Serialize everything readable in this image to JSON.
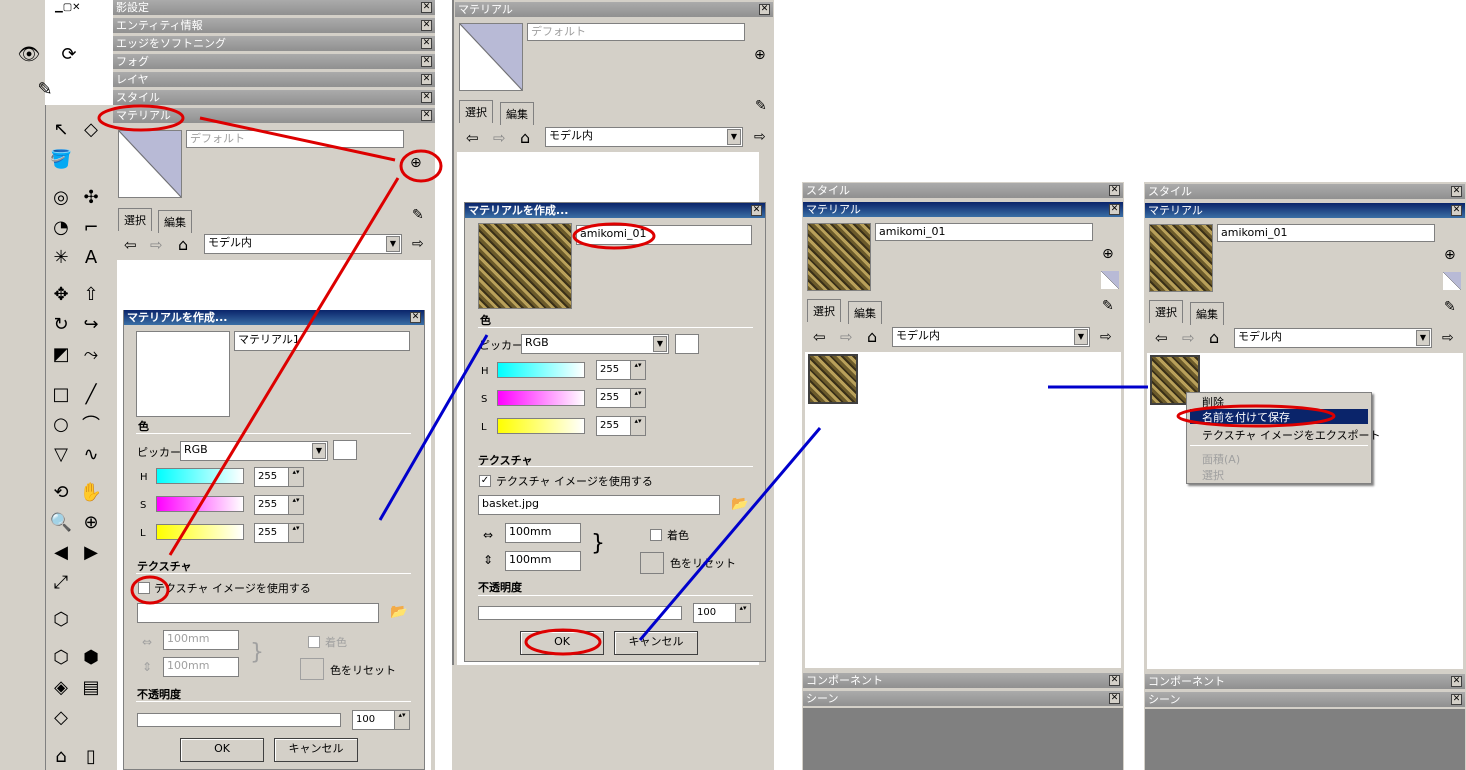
{
  "colors": {
    "blue_annot": "#0000cc",
    "red_annot": "#dd0000",
    "panel": "#d4d0c8"
  },
  "panels": {
    "shadow": "影設定",
    "entity": "エンティティ情報",
    "soften": "エッジをソフトニング",
    "fog": "フォグ",
    "layer": "レイヤ",
    "style": "スタイル",
    "material": "マテリアル",
    "component": "コンポーネント",
    "scene": "シーン"
  },
  "tabs": {
    "select": "選択",
    "edit": "編集"
  },
  "model": "モデル内",
  "default_name": "デフォルト",
  "create": {
    "title": "マテリアルを作成...",
    "name1": "マテリアル1",
    "name2": "amikomi_01",
    "color_section": "色",
    "picker_label": "ピッカー:",
    "picker": "RGB",
    "h": "H",
    "s": "S",
    "l": "L",
    "val": "255",
    "texture_section": "テクスチャ",
    "use_texture": "テクスチャ イメージを使用する",
    "file": "basket.jpg",
    "w": "100mm",
    "hgt": "100mm",
    "colorize": "着色",
    "reset": "色をリセット",
    "opacity": "不透明度",
    "opacity_val": "100",
    "ok": "OK",
    "cancel": "キャンセル"
  },
  "menu": {
    "delete": "削除",
    "save_as": "名前を付けて保存",
    "export": "テクスチャ イメージをエクスポート",
    "area": "面積(A)",
    "select": "選択"
  }
}
